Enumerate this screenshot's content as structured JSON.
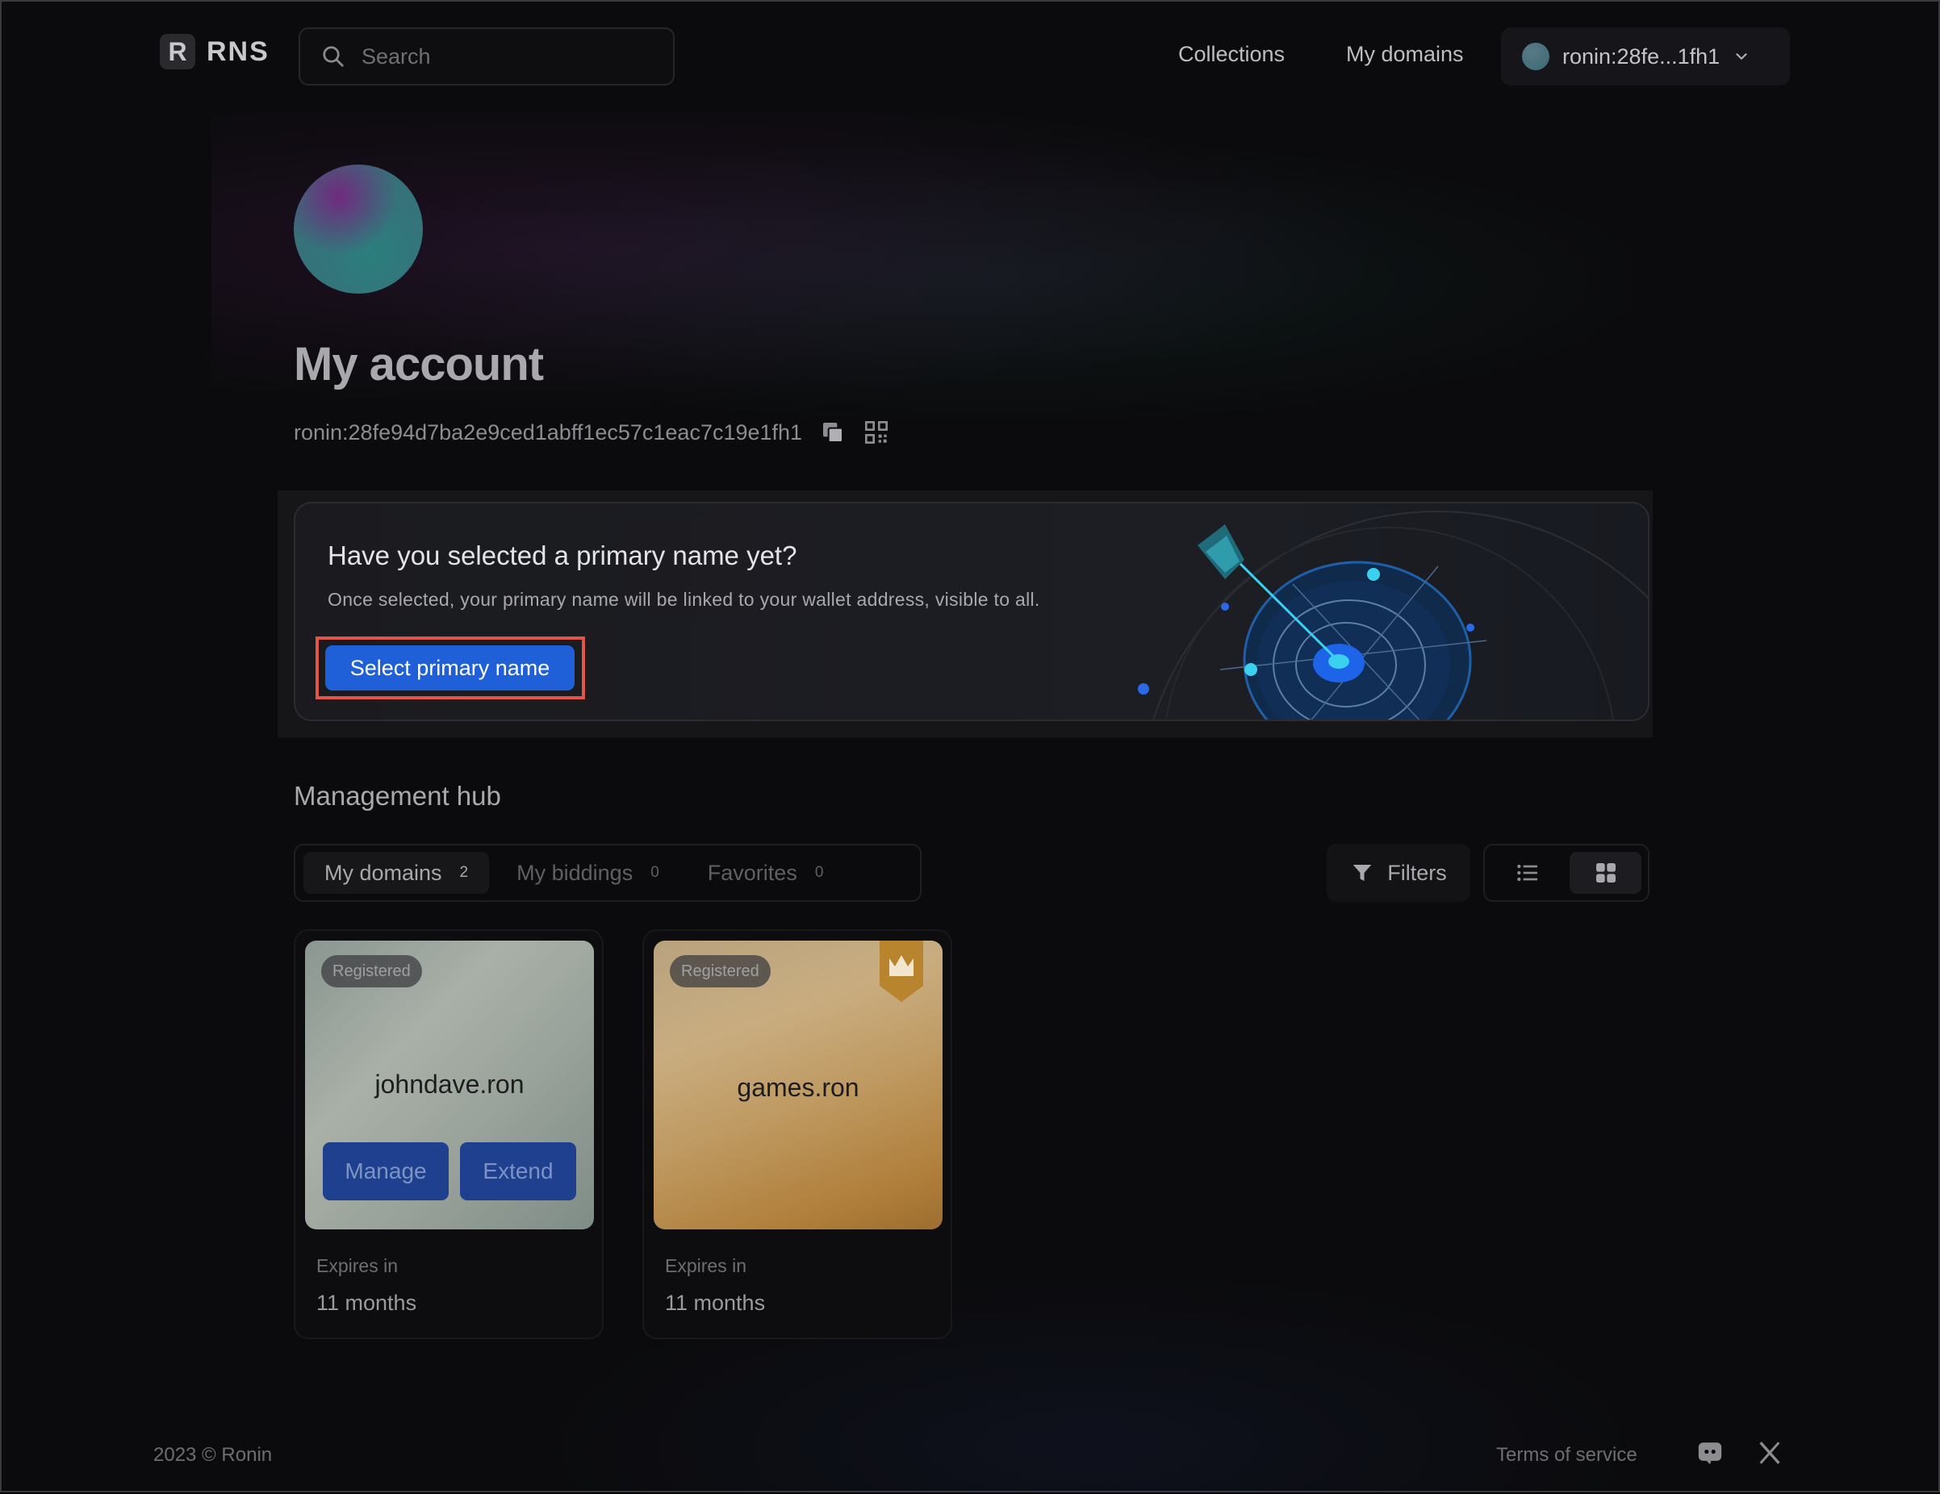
{
  "header": {
    "logo_letter": "R",
    "logo_text": "RNS",
    "search_placeholder": "Search",
    "nav": [
      "Collections",
      "My domains"
    ],
    "account_label": "ronin:28fe...1fh1"
  },
  "profile": {
    "title": "My account",
    "address": "ronin:28fe94d7ba2e9ced1abff1ec57c1eac7c19e1fh1"
  },
  "banner": {
    "title": "Have you selected a primary name yet?",
    "subtitle": "Once selected, your primary name will be linked to your wallet address, visible to all.",
    "button": "Select primary name"
  },
  "management": {
    "title": "Management hub",
    "tabs": [
      {
        "label": "My domains",
        "count": "2"
      },
      {
        "label": "My biddings",
        "count": "0"
      },
      {
        "label": "Favorites",
        "count": "0"
      }
    ],
    "filters_label": "Filters"
  },
  "domains": [
    {
      "badge": "Registered",
      "name": "johndave.ron",
      "manage": "Manage",
      "extend": "Extend",
      "expires_label": "Expires in",
      "expires_value": "11 months"
    },
    {
      "badge": "Registered",
      "name": "games.ron",
      "expires_label": "Expires in",
      "expires_value": "11 months"
    }
  ],
  "footer": {
    "copyright": "2023 © Ronin",
    "terms": "Terms of service"
  },
  "colors": {
    "accent": "#1f60d9",
    "highlight": "#e2564a",
    "background": "#0b0b0d"
  }
}
